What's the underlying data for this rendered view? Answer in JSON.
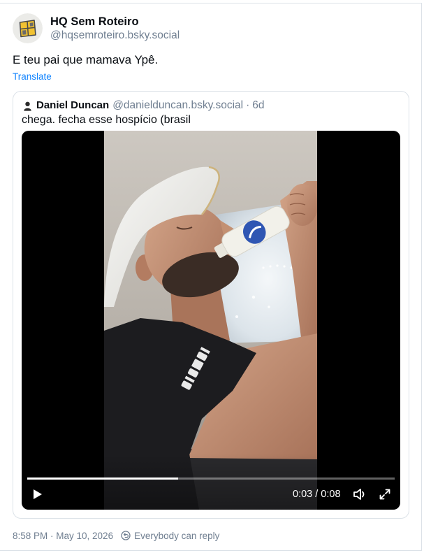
{
  "post": {
    "author": {
      "display_name": "HQ Sem Roteiro",
      "handle": "@hqsemroteiro.bsky.social",
      "avatar_icon": "hq-sem-roteiro-logo-avatar"
    },
    "text": "E teu pai que mamava Ypê.",
    "translate_label": "Translate",
    "quote": {
      "author": {
        "display_name": "Daniel Duncan",
        "handle": "@danielduncan.bsky.social",
        "separator": "·",
        "age": "6d",
        "avatar_icon": "daniel-duncan-avatar"
      },
      "text": "chega. fecha esse hospício (brasil",
      "video": {
        "time_display": "0:03 / 0:08",
        "progress": 0.41,
        "play_icon": "play-icon",
        "volume_icon": "volume-icon",
        "fullscreen_icon": "fullscreen-icon"
      }
    },
    "footer": {
      "timestamp": "8:58 PM · May 10, 2026",
      "reply_setting": "Everybody can reply",
      "reply_setting_icon": "everybody-can-reply-icon"
    }
  },
  "colors": {
    "text": "#0b0f14",
    "muted": "#6f7e90",
    "link": "#1083fe",
    "border": "#dce2e8",
    "video_bg": "#000000",
    "controls": "#ffffff"
  }
}
